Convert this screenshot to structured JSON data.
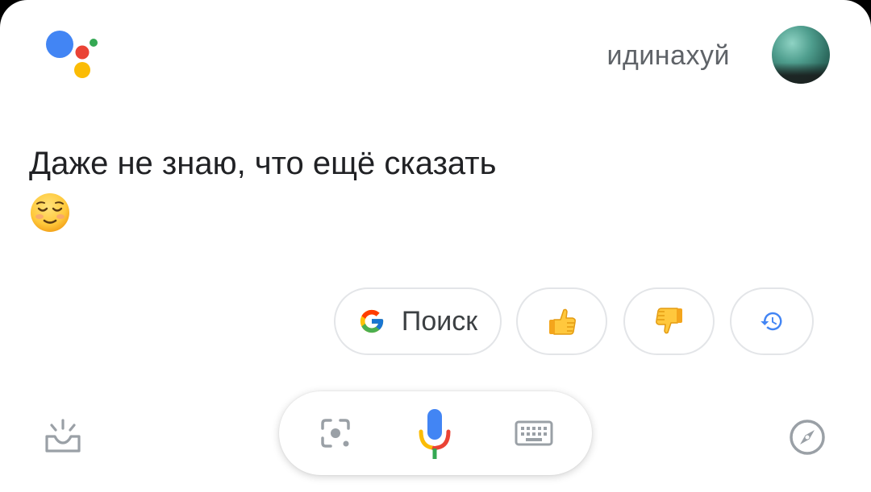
{
  "header": {
    "user_name": "идинахуй"
  },
  "response": {
    "text": "Даже не знаю, что ещё сказать",
    "emoji": "relieved-face"
  },
  "suggestions": {
    "search_label": "Поиск",
    "like_icon": "thumbs-up-icon",
    "dislike_icon": "thumbs-down-icon",
    "history_icon": "history-icon"
  },
  "bottom_bar": {
    "left_icon": "updates-icon",
    "input_icons": [
      "lens-icon",
      "mic-icon",
      "keyboard-icon"
    ],
    "right_icon": "explore-icon"
  },
  "colors": {
    "google_blue": "#4285F4",
    "google_red": "#EA4335",
    "google_yellow": "#FBBC05",
    "google_green": "#34A853",
    "icon_gray": "#9aa0a6",
    "text_dark": "#202124",
    "text_muted": "#5f6368"
  }
}
